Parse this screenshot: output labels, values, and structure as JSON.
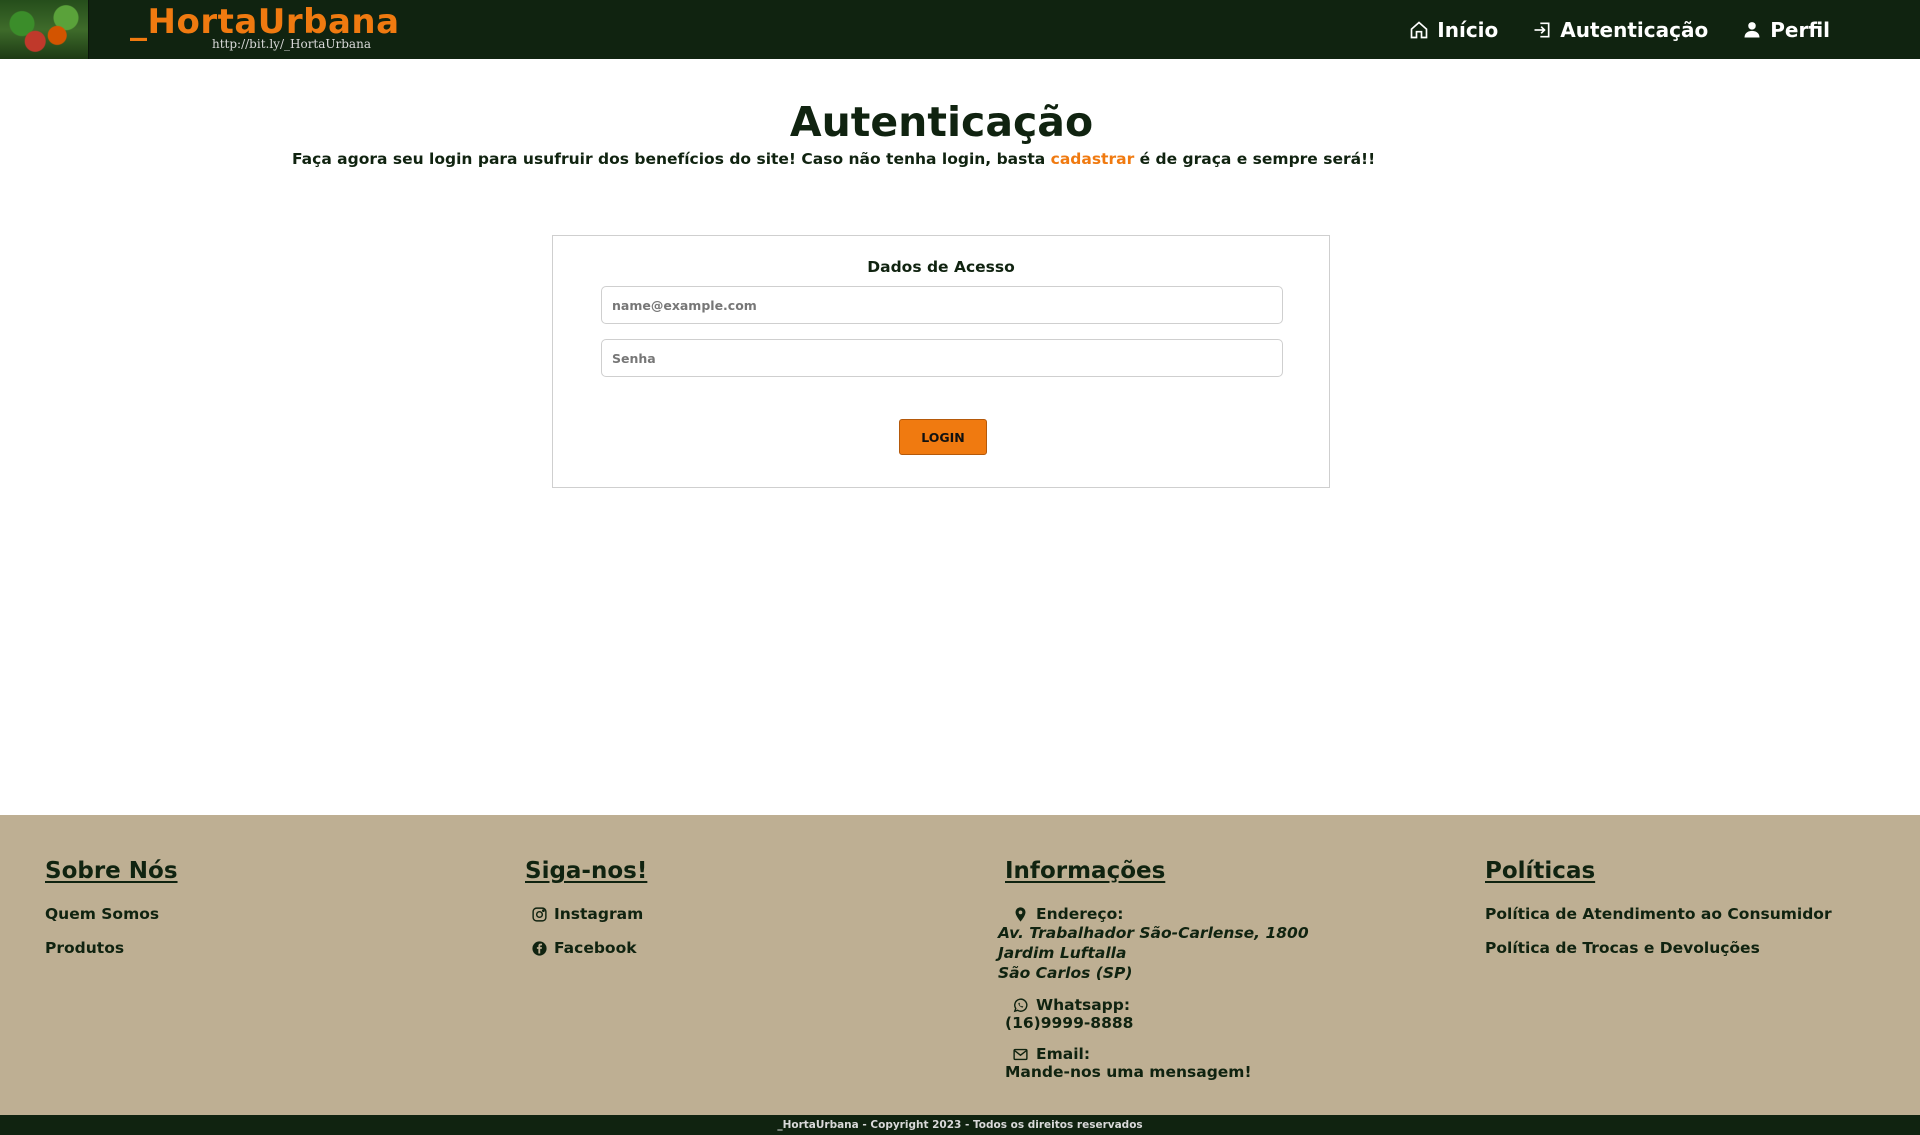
{
  "header": {
    "brand": "_HortaUrbana",
    "brand_url": "http://bit.ly/_HortaUrbana",
    "nav": [
      {
        "label": "Início",
        "icon": "home-icon"
      },
      {
        "label": "Autenticação",
        "icon": "login-icon"
      },
      {
        "label": "Perfil",
        "icon": "user-icon"
      }
    ]
  },
  "main": {
    "title": "Autenticação",
    "intro_before": "Faça agora seu login para usufruir dos benefícios do site! Caso não tenha login, basta ",
    "intro_link": "cadastrar",
    "intro_after": " é de graça e sempre será!!",
    "form": {
      "title": "Dados de Acesso",
      "email_placeholder": "name@example.com",
      "email_value": "",
      "password_placeholder": "Senha",
      "password_value": "",
      "login_label": "LOGIN"
    }
  },
  "footer": {
    "sobre": {
      "title": "Sobre Nós",
      "links": [
        "Quem Somos",
        "Produtos"
      ]
    },
    "siga": {
      "title": "Siga-nos!",
      "links": [
        {
          "label": "Instagram",
          "icon": "instagram-icon"
        },
        {
          "label": "Facebook",
          "icon": "facebook-icon"
        }
      ]
    },
    "info": {
      "title": "Informações",
      "address_label": "Endereço:",
      "address_lines": [
        "Av. Trabalhador São-Carlense, 1800",
        "Jardim Luftalla",
        "São Carlos (SP)"
      ],
      "whatsapp_label": "Whatsapp:",
      "whatsapp_value": "(16)9999-8888",
      "email_label": "Email:",
      "email_value": "Mande-nos uma mensagem!"
    },
    "politicas": {
      "title": "Políticas",
      "links": [
        "Política de Atendimento ao Consumidor",
        "Política de Trocas e Devoluções"
      ]
    },
    "copyright": "_HortaUrbana - Copyright 2023 - Todos os direitos reservados"
  },
  "colors": {
    "primary_dark": "#102310",
    "accent": "#f07a10",
    "footer_bg": "#beaf93"
  }
}
